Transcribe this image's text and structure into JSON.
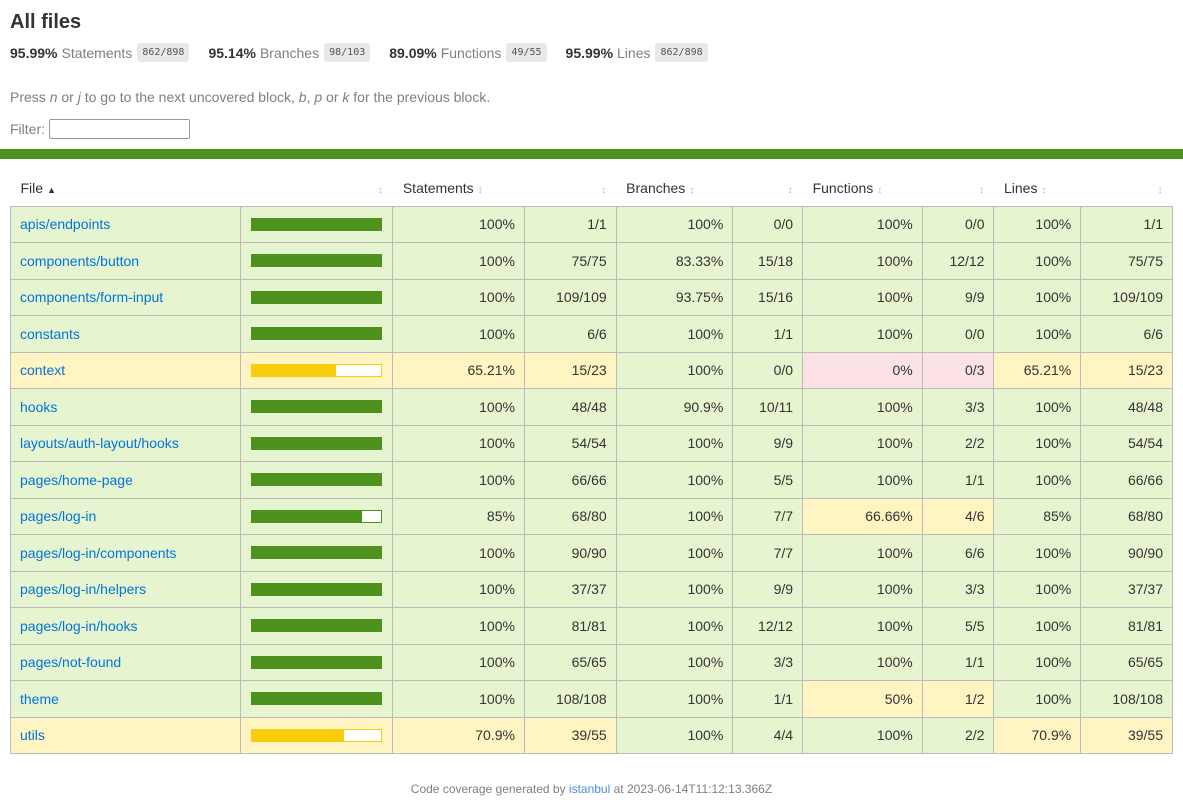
{
  "header": {
    "title": "All files",
    "summary": [
      {
        "pct": "95.99%",
        "label": "Statements",
        "fraction": "862/898"
      },
      {
        "pct": "95.14%",
        "label": "Branches",
        "fraction": "98/103"
      },
      {
        "pct": "89.09%",
        "label": "Functions",
        "fraction": "49/55"
      },
      {
        "pct": "95.99%",
        "label": "Lines",
        "fraction": "862/898"
      }
    ],
    "hint": {
      "p1": "Press ",
      "k1": "n",
      "p2": " or ",
      "k2": "j",
      "p3": " to go to the next uncovered block, ",
      "k3": "b",
      "p4": ", ",
      "k4": "p",
      "p5": " or ",
      "k5": "k",
      "p6": " for the previous block."
    },
    "filter_label": "Filter:",
    "filter_value": ""
  },
  "colors": {
    "high": "#4d921f",
    "medium": "#f9cd0b",
    "low": "#c21f39",
    "high_bg": "#e6f5d0",
    "medium_bg": "#fff4c2",
    "low_bg": "#fce1e5",
    "link": "#0074d9"
  },
  "table": {
    "columns": [
      {
        "label": "File",
        "sort": "asc"
      },
      {
        "label": "",
        "sort": "none"
      },
      {
        "label": "Statements",
        "sort": "none"
      },
      {
        "label": "",
        "sort": "none"
      },
      {
        "label": "Branches",
        "sort": "none"
      },
      {
        "label": "",
        "sort": "none"
      },
      {
        "label": "Functions",
        "sort": "none"
      },
      {
        "label": "",
        "sort": "none"
      },
      {
        "label": "Lines",
        "sort": "none"
      },
      {
        "label": "",
        "sort": "none"
      }
    ],
    "rows": [
      {
        "file": "apis/endpoints",
        "coverage": 100,
        "level": "high",
        "statements": {
          "pct": "100%",
          "frac": "1/1",
          "level": "high"
        },
        "branches": {
          "pct": "100%",
          "frac": "0/0",
          "level": "high"
        },
        "functions": {
          "pct": "100%",
          "frac": "0/0",
          "level": "high"
        },
        "lines": {
          "pct": "100%",
          "frac": "1/1",
          "level": "high"
        }
      },
      {
        "file": "components/button",
        "coverage": 100,
        "level": "high",
        "statements": {
          "pct": "100%",
          "frac": "75/75",
          "level": "high"
        },
        "branches": {
          "pct": "83.33%",
          "frac": "15/18",
          "level": "high"
        },
        "functions": {
          "pct": "100%",
          "frac": "12/12",
          "level": "high"
        },
        "lines": {
          "pct": "100%",
          "frac": "75/75",
          "level": "high"
        }
      },
      {
        "file": "components/form-input",
        "coverage": 100,
        "level": "high",
        "statements": {
          "pct": "100%",
          "frac": "109/109",
          "level": "high"
        },
        "branches": {
          "pct": "93.75%",
          "frac": "15/16",
          "level": "high"
        },
        "functions": {
          "pct": "100%",
          "frac": "9/9",
          "level": "high"
        },
        "lines": {
          "pct": "100%",
          "frac": "109/109",
          "level": "high"
        }
      },
      {
        "file": "constants",
        "coverage": 100,
        "level": "high",
        "statements": {
          "pct": "100%",
          "frac": "6/6",
          "level": "high"
        },
        "branches": {
          "pct": "100%",
          "frac": "1/1",
          "level": "high"
        },
        "functions": {
          "pct": "100%",
          "frac": "0/0",
          "level": "high"
        },
        "lines": {
          "pct": "100%",
          "frac": "6/6",
          "level": "high"
        }
      },
      {
        "file": "context",
        "coverage": 65.21,
        "level": "medium",
        "statements": {
          "pct": "65.21%",
          "frac": "15/23",
          "level": "medium"
        },
        "branches": {
          "pct": "100%",
          "frac": "0/0",
          "level": "high"
        },
        "functions": {
          "pct": "0%",
          "frac": "0/3",
          "level": "low"
        },
        "lines": {
          "pct": "65.21%",
          "frac": "15/23",
          "level": "medium"
        }
      },
      {
        "file": "hooks",
        "coverage": 100,
        "level": "high",
        "statements": {
          "pct": "100%",
          "frac": "48/48",
          "level": "high"
        },
        "branches": {
          "pct": "90.9%",
          "frac": "10/11",
          "level": "high"
        },
        "functions": {
          "pct": "100%",
          "frac": "3/3",
          "level": "high"
        },
        "lines": {
          "pct": "100%",
          "frac": "48/48",
          "level": "high"
        }
      },
      {
        "file": "layouts/auth-layout/hooks",
        "coverage": 100,
        "level": "high",
        "statements": {
          "pct": "100%",
          "frac": "54/54",
          "level": "high"
        },
        "branches": {
          "pct": "100%",
          "frac": "9/9",
          "level": "high"
        },
        "functions": {
          "pct": "100%",
          "frac": "2/2",
          "level": "high"
        },
        "lines": {
          "pct": "100%",
          "frac": "54/54",
          "level": "high"
        }
      },
      {
        "file": "pages/home-page",
        "coverage": 100,
        "level": "high",
        "statements": {
          "pct": "100%",
          "frac": "66/66",
          "level": "high"
        },
        "branches": {
          "pct": "100%",
          "frac": "5/5",
          "level": "high"
        },
        "functions": {
          "pct": "100%",
          "frac": "1/1",
          "level": "high"
        },
        "lines": {
          "pct": "100%",
          "frac": "66/66",
          "level": "high"
        }
      },
      {
        "file": "pages/log-in",
        "coverage": 85,
        "level": "high",
        "statements": {
          "pct": "85%",
          "frac": "68/80",
          "level": "high"
        },
        "branches": {
          "pct": "100%",
          "frac": "7/7",
          "level": "high"
        },
        "functions": {
          "pct": "66.66%",
          "frac": "4/6",
          "level": "medium"
        },
        "lines": {
          "pct": "85%",
          "frac": "68/80",
          "level": "high"
        }
      },
      {
        "file": "pages/log-in/components",
        "coverage": 100,
        "level": "high",
        "statements": {
          "pct": "100%",
          "frac": "90/90",
          "level": "high"
        },
        "branches": {
          "pct": "100%",
          "frac": "7/7",
          "level": "high"
        },
        "functions": {
          "pct": "100%",
          "frac": "6/6",
          "level": "high"
        },
        "lines": {
          "pct": "100%",
          "frac": "90/90",
          "level": "high"
        }
      },
      {
        "file": "pages/log-in/helpers",
        "coverage": 100,
        "level": "high",
        "statements": {
          "pct": "100%",
          "frac": "37/37",
          "level": "high"
        },
        "branches": {
          "pct": "100%",
          "frac": "9/9",
          "level": "high"
        },
        "functions": {
          "pct": "100%",
          "frac": "3/3",
          "level": "high"
        },
        "lines": {
          "pct": "100%",
          "frac": "37/37",
          "level": "high"
        }
      },
      {
        "file": "pages/log-in/hooks",
        "coverage": 100,
        "level": "high",
        "statements": {
          "pct": "100%",
          "frac": "81/81",
          "level": "high"
        },
        "branches": {
          "pct": "100%",
          "frac": "12/12",
          "level": "high"
        },
        "functions": {
          "pct": "100%",
          "frac": "5/5",
          "level": "high"
        },
        "lines": {
          "pct": "100%",
          "frac": "81/81",
          "level": "high"
        }
      },
      {
        "file": "pages/not-found",
        "coverage": 100,
        "level": "high",
        "statements": {
          "pct": "100%",
          "frac": "65/65",
          "level": "high"
        },
        "branches": {
          "pct": "100%",
          "frac": "3/3",
          "level": "high"
        },
        "functions": {
          "pct": "100%",
          "frac": "1/1",
          "level": "high"
        },
        "lines": {
          "pct": "100%",
          "frac": "65/65",
          "level": "high"
        }
      },
      {
        "file": "theme",
        "coverage": 100,
        "level": "high",
        "statements": {
          "pct": "100%",
          "frac": "108/108",
          "level": "high"
        },
        "branches": {
          "pct": "100%",
          "frac": "1/1",
          "level": "high"
        },
        "functions": {
          "pct": "50%",
          "frac": "1/2",
          "level": "medium"
        },
        "lines": {
          "pct": "100%",
          "frac": "108/108",
          "level": "high"
        }
      },
      {
        "file": "utils",
        "coverage": 70.9,
        "level": "medium",
        "statements": {
          "pct": "70.9%",
          "frac": "39/55",
          "level": "medium"
        },
        "branches": {
          "pct": "100%",
          "frac": "4/4",
          "level": "high"
        },
        "functions": {
          "pct": "100%",
          "frac": "2/2",
          "level": "high"
        },
        "lines": {
          "pct": "70.9%",
          "frac": "39/55",
          "level": "medium"
        }
      }
    ]
  },
  "footer": {
    "prefix": "Code coverage generated by ",
    "link": "istanbul",
    "suffix": " at 2023-06-14T11:12:13.366Z"
  }
}
